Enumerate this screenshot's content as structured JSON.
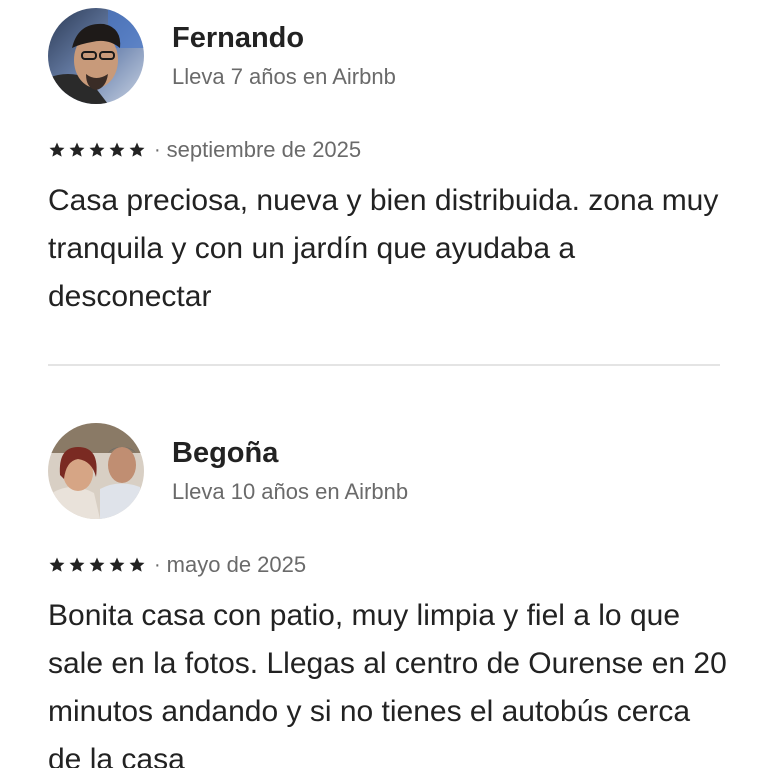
{
  "colors": {
    "text_primary": "#222222",
    "text_secondary": "#6a6a6a",
    "star": "#222222",
    "divider": "#e4e4e4"
  },
  "reviews": [
    {
      "name": "Fernando",
      "tenure": "Lleva 7 años en Airbnb",
      "rating": 5,
      "date": "septiembre de 2025",
      "text": "Casa preciosa, nueva y bien distribuida. zona muy tranquila y con un jardín que ayudaba a desconectar",
      "avatar_icon": "user-avatar-photo"
    },
    {
      "name": "Begoña",
      "tenure": "Lleva 10 años en Airbnb",
      "rating": 5,
      "date": "mayo de 2025",
      "text": "Bonita casa con patio, muy limpia y fiel a lo que sale en la fotos. Llegas al centro de Ourense en 20 minutos andando y si no tienes el autobús cerca de la casa",
      "avatar_icon": "user-avatar-photo"
    }
  ]
}
